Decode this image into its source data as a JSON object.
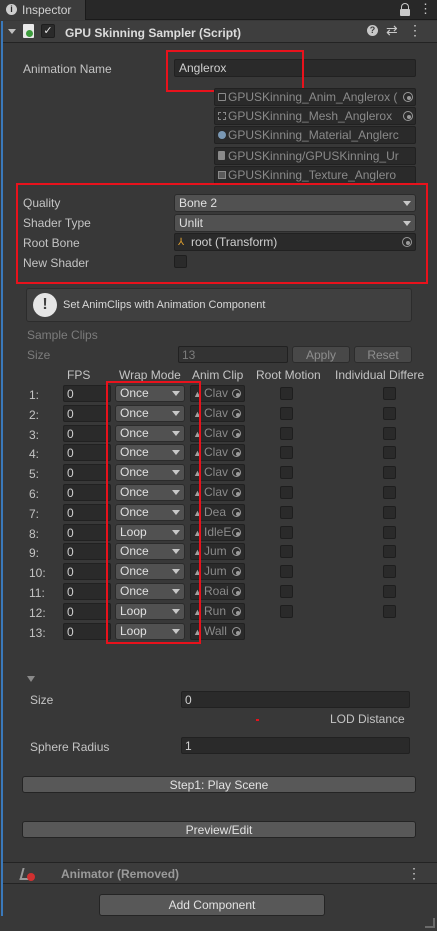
{
  "window": {
    "tab_title": "Inspector"
  },
  "component": {
    "title": "GPU Skinning Sampler (Script)"
  },
  "animation": {
    "name_label": "Animation Name",
    "name_value": "Anglerox",
    "assets": [
      "GPUSKinning_Anim_Anglerox (",
      "GPUSKinning_Mesh_Anglerox",
      "GPUSKinning_Material_Anglerc",
      "GPUSKinning/GPUSKinning_Ur",
      "GPUSKinning_Texture_Anglero"
    ]
  },
  "settings": {
    "quality_label": "Quality",
    "quality_value": "Bone 2",
    "shader_type_label": "Shader Type",
    "shader_type_value": "Unlit",
    "root_bone_label": "Root Bone",
    "root_bone_value": "root (Transform)",
    "new_shader_label": "New Shader"
  },
  "help": {
    "text": "Set AnimClips with Animation Component"
  },
  "sample": {
    "title": "Sample Clips",
    "size_label": "Size",
    "size_value": "13",
    "apply": "Apply",
    "reset": "Reset"
  },
  "table": {
    "headers": {
      "fps": "FPS",
      "wrap": "Wrap Mode",
      "clip": "Anim Clip",
      "root": "Root Motion",
      "indiv": "Individual Differe"
    },
    "rows": [
      {
        "idx": "1:",
        "fps": "0",
        "wrap": "Once",
        "clip": "Clav",
        "has_toggles": true
      },
      {
        "idx": "2:",
        "fps": "0",
        "wrap": "Once",
        "clip": "Clav",
        "has_toggles": true
      },
      {
        "idx": "3:",
        "fps": "0",
        "wrap": "Once",
        "clip": "Clav",
        "has_toggles": true
      },
      {
        "idx": "4:",
        "fps": "0",
        "wrap": "Once",
        "clip": "Clav",
        "has_toggles": true
      },
      {
        "idx": "5:",
        "fps": "0",
        "wrap": "Once",
        "clip": "Clav",
        "has_toggles": true
      },
      {
        "idx": "6:",
        "fps": "0",
        "wrap": "Once",
        "clip": "Clav",
        "has_toggles": true
      },
      {
        "idx": "7:",
        "fps": "0",
        "wrap": "Once",
        "clip": "Dea",
        "has_toggles": true
      },
      {
        "idx": "8:",
        "fps": "0",
        "wrap": "Loop",
        "clip": "IdleE",
        "has_toggles": true
      },
      {
        "idx": "9:",
        "fps": "0",
        "wrap": "Once",
        "clip": "Jum",
        "has_toggles": true
      },
      {
        "idx": "10:",
        "fps": "0",
        "wrap": "Once",
        "clip": "Jum",
        "has_toggles": true
      },
      {
        "idx": "11:",
        "fps": "0",
        "wrap": "Once",
        "clip": "Roai",
        "has_toggles": true
      },
      {
        "idx": "12:",
        "fps": "0",
        "wrap": "Loop",
        "clip": "Run",
        "has_toggles": true
      },
      {
        "idx": "13:",
        "fps": "0",
        "wrap": "Loop",
        "clip": "Wall",
        "has_toggles": false
      }
    ]
  },
  "lod": {
    "size_label": "Size",
    "size_value": "0",
    "lod_distance_label": "LOD Distance",
    "sphere_radius_label": "Sphere Radius",
    "sphere_radius_value": "1"
  },
  "buttons": {
    "step1": "Step1: Play Scene",
    "preview": "Preview/Edit",
    "add_component": "Add Component"
  },
  "animator": {
    "title": "Animator (Removed)"
  },
  "colors": {
    "highlight": "#e8121c",
    "accent_blue": "#3a79bb"
  }
}
